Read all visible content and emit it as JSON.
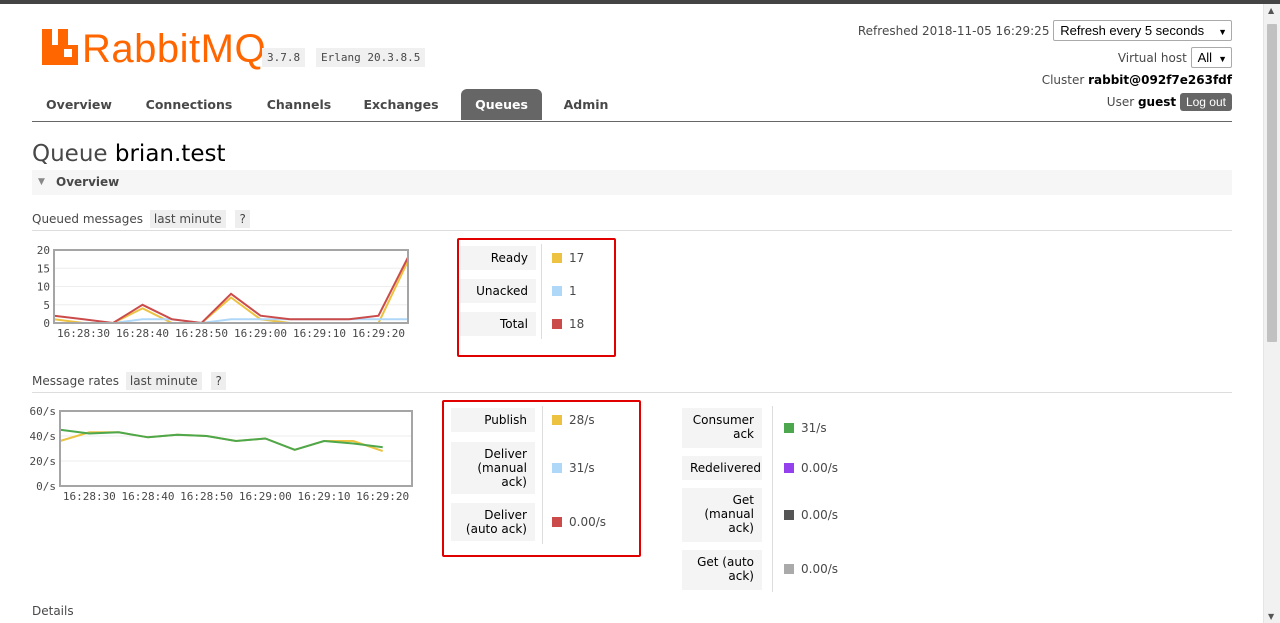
{
  "colors": {
    "brand": "#ff6600",
    "ready": "#edc240",
    "unacked": "#afd8f8",
    "total": "#cb4b4b",
    "publish": "#edc240",
    "deliver_manual": "#afd8f8",
    "deliver_auto": "#cb4b4b",
    "consumer_ack": "#4da74d",
    "redelivered": "#9440ed",
    "get_manual": "#555555",
    "get_auto": "#aaaaaa"
  },
  "header": {
    "logo_text": "RabbitMQ",
    "logo_tm": "TM",
    "version": "3.7.8",
    "erlang": "Erlang 20.3.8.5",
    "refreshed": "Refreshed 2018-11-05 16:29:25",
    "refresh_select": "Refresh every 5 seconds",
    "vhost_label": "Virtual host",
    "vhost_select": "All",
    "cluster_label": "Cluster",
    "cluster_name": "rabbit@092f7e263fdf",
    "user_label": "User",
    "user_name": "guest",
    "logout": "Log out"
  },
  "nav": {
    "tabs": [
      "Overview",
      "Connections",
      "Channels",
      "Exchanges",
      "Queues",
      "Admin"
    ],
    "active": "Queues"
  },
  "page": {
    "title_prefix": "Queue",
    "queue_name": "brian.test",
    "section": "Overview",
    "details": "Details"
  },
  "queued": {
    "heading": "Queued messages",
    "range": "last minute",
    "help": "?",
    "stats": [
      {
        "label": "Ready",
        "value": "17"
      },
      {
        "label": "Unacked",
        "value": "1"
      },
      {
        "label": "Total",
        "value": "18"
      }
    ]
  },
  "rates": {
    "heading": "Message rates",
    "range": "last minute",
    "help": "?",
    "left": [
      {
        "label": "Publish",
        "value": "28/s"
      },
      {
        "label": "Deliver (manual ack)",
        "value": "31/s"
      },
      {
        "label": "Deliver (auto ack)",
        "value": "0.00/s"
      }
    ],
    "right": [
      {
        "label": "Consumer ack",
        "value": "31/s"
      },
      {
        "label": "Redelivered",
        "value": "0.00/s"
      },
      {
        "label": "Get (manual ack)",
        "value": "0.00/s"
      },
      {
        "label": "Get (auto ack)",
        "value": "0.00/s"
      }
    ]
  },
  "chart_data": [
    {
      "type": "line",
      "x": [
        "16:28:25",
        "16:28:30",
        "16:28:35",
        "16:28:40",
        "16:28:45",
        "16:28:50",
        "16:28:55",
        "16:29:00",
        "16:29:05",
        "16:29:10",
        "16:29:15",
        "16:29:20",
        "16:29:25"
      ],
      "x_ticks": [
        "16:28:30",
        "16:28:40",
        "16:28:50",
        "16:29:00",
        "16:29:10",
        "16:29:20"
      ],
      "y_ticks": [
        "20",
        "15",
        "10",
        "5",
        "0"
      ],
      "ylim": [
        0,
        20
      ],
      "series": [
        {
          "name": "Ready",
          "values": [
            1,
            0,
            0,
            4,
            0,
            0,
            7,
            1,
            0,
            0,
            0,
            0,
            17
          ]
        },
        {
          "name": "Unacked",
          "values": [
            0,
            0,
            0,
            1,
            1,
            0,
            1,
            1,
            1,
            1,
            1,
            1,
            1
          ]
        },
        {
          "name": "Total",
          "values": [
            2,
            1,
            0,
            5,
            1,
            0,
            8,
            2,
            1,
            1,
            1,
            2,
            18
          ]
        }
      ]
    },
    {
      "type": "line",
      "x": [
        "16:28:25",
        "16:28:30",
        "16:28:35",
        "16:28:40",
        "16:28:45",
        "16:28:50",
        "16:28:55",
        "16:29:00",
        "16:29:05",
        "16:29:10",
        "16:29:15",
        "16:29:20",
        "16:29:25"
      ],
      "x_ticks": [
        "16:28:30",
        "16:28:40",
        "16:28:50",
        "16:29:00",
        "16:29:10",
        "16:29:20"
      ],
      "y_ticks": [
        "60/s",
        "40/s",
        "20/s",
        "0/s"
      ],
      "ylim": [
        0,
        60
      ],
      "series": [
        {
          "name": "Publish",
          "values": [
            36,
            43,
            43,
            39,
            41,
            40,
            36,
            38,
            29,
            36,
            36,
            28
          ]
        },
        {
          "name": "Consumer ack",
          "values": [
            45,
            42,
            43,
            39,
            41,
            40,
            36,
            38,
            29,
            36,
            34,
            31
          ]
        }
      ]
    }
  ]
}
